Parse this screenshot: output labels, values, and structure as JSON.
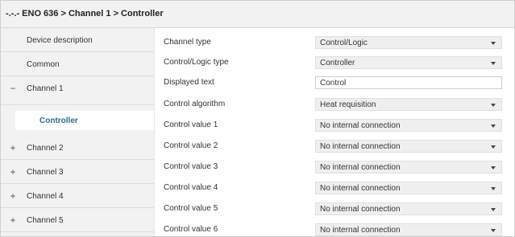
{
  "header": {
    "title": "-.-.- ENO 636 > Channel 1 > Controller"
  },
  "sidebar": {
    "items": [
      {
        "label": "Device description",
        "sign": ""
      },
      {
        "label": "Common",
        "sign": ""
      },
      {
        "label": "Channel 1",
        "sign": "−"
      },
      {
        "label": "Controller",
        "sign": ""
      },
      {
        "label": "Channel 2",
        "sign": "+"
      },
      {
        "label": "Channel 3",
        "sign": "+"
      },
      {
        "label": "Channel 4",
        "sign": "+"
      },
      {
        "label": "Channel 5",
        "sign": "+"
      }
    ]
  },
  "params": [
    {
      "label": "Channel type",
      "value": "Control/Logic",
      "kind": "select"
    },
    {
      "label": "Control/Logic type",
      "value": "Controller",
      "kind": "select"
    },
    {
      "label": "Displayed text",
      "value": "Control",
      "kind": "text"
    },
    {
      "label": "Control algorithm",
      "value": "Heat requisition",
      "kind": "select"
    },
    {
      "label": "Control value 1",
      "value": "No internal connection",
      "kind": "select"
    },
    {
      "label": "Control value 2",
      "value": "No internal connection",
      "kind": "select"
    },
    {
      "label": "Control value 3",
      "value": "No internal connection",
      "kind": "select"
    },
    {
      "label": "Control value 4",
      "value": "No internal connection",
      "kind": "select"
    },
    {
      "label": "Control value 5",
      "value": "No internal connection",
      "kind": "select"
    },
    {
      "label": "Control value 6",
      "value": "No internal connection",
      "kind": "select"
    }
  ]
}
